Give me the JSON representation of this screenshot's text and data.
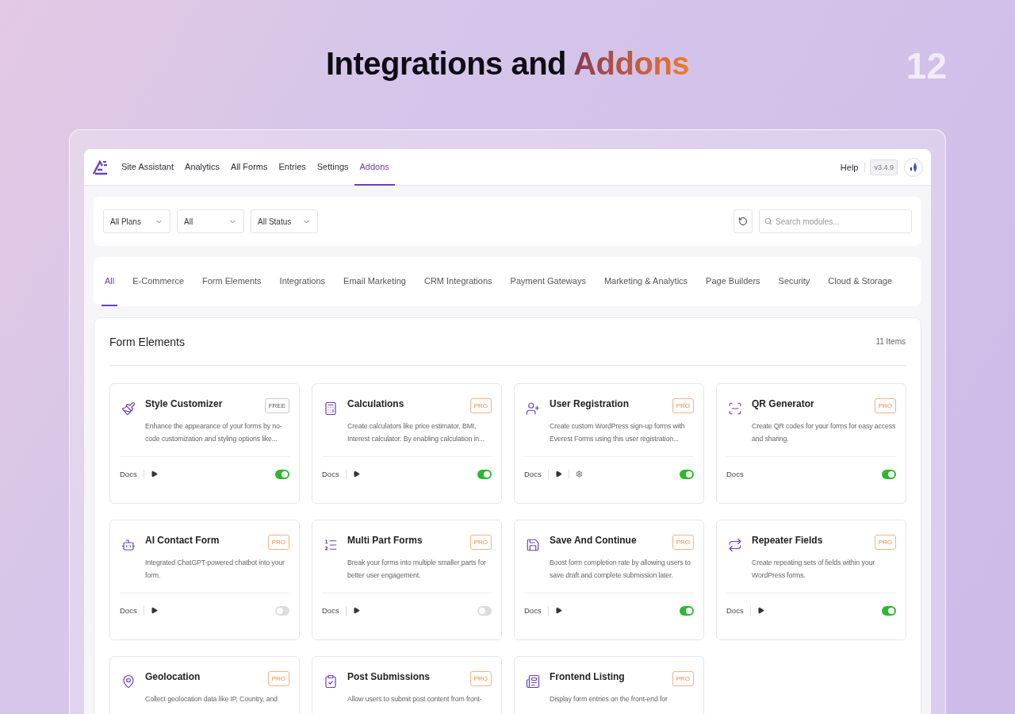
{
  "headline": {
    "prefix": "Integrations and",
    "highlight": "Addons",
    "page_number": "12"
  },
  "nav": {
    "items": [
      {
        "label": "Site Assistant",
        "selected": false
      },
      {
        "label": "Analytics",
        "selected": false
      },
      {
        "label": "All Forms",
        "selected": false
      },
      {
        "label": "Entries",
        "selected": false
      },
      {
        "label": "Settings",
        "selected": false
      },
      {
        "label": "Addons",
        "selected": true
      }
    ],
    "help": "Help",
    "version": "v3.4.9"
  },
  "filters": {
    "selects": [
      "All Plans",
      "All",
      "All Status"
    ],
    "search": {
      "placeholder": "Search modules..."
    }
  },
  "categories": [
    {
      "label": "All",
      "selected": true
    },
    {
      "label": "E-Commerce",
      "selected": false
    },
    {
      "label": "Form Elements",
      "selected": false
    },
    {
      "label": "Integrations",
      "selected": false
    },
    {
      "label": "Email Marketing",
      "selected": false
    },
    {
      "label": "CRM Integrations",
      "selected": false
    },
    {
      "label": "Payment Gateways",
      "selected": false
    },
    {
      "label": "Marketing & Analytics",
      "selected": false
    },
    {
      "label": "Page Builders",
      "selected": false
    },
    {
      "label": "Security",
      "selected": false
    },
    {
      "label": "Cloud & Storage",
      "selected": false
    }
  ],
  "section": {
    "title": "Form Elements",
    "count": "11 Items"
  },
  "addons": [
    {
      "name": "Style Customizer",
      "badge": {
        "label": "FREE",
        "kind": "free"
      },
      "description": "Enhance the appearance of your forms by no-code customization and styling options like...",
      "docs": "Docs",
      "video": true,
      "settings": false,
      "enabled": true
    },
    {
      "name": "Calculations",
      "badge": {
        "label": "PRO",
        "kind": "pro"
      },
      "description": "Create calculators like price estimator, BMI, Interest calculator. By enabling calculation in...",
      "docs": "Docs",
      "video": true,
      "settings": false,
      "enabled": true
    },
    {
      "name": "User Registration",
      "badge": {
        "label": "PRO",
        "kind": "pro"
      },
      "description": "Create custom WordPress sign-up forms with Everest Forms using this user registration...",
      "docs": "Docs",
      "video": true,
      "settings": true,
      "enabled": true
    },
    {
      "name": "QR Generator",
      "badge": {
        "label": "PRO",
        "kind": "pro"
      },
      "description": "Create QR codes for your forms for easy access and sharing.",
      "docs": "Docs",
      "video": false,
      "settings": false,
      "enabled": true
    },
    {
      "name": "AI Contact Form",
      "badge": {
        "label": "PRO",
        "kind": "pro"
      },
      "description": "Integrated ChatGPT-powered chatbot into your form.",
      "docs": "Docs",
      "video": true,
      "settings": false,
      "enabled": false
    },
    {
      "name": "Multi Part Forms",
      "badge": {
        "label": "PRO",
        "kind": "pro"
      },
      "description": "Break your forms into multiple smaller parts for better user engagement.",
      "docs": "Docs",
      "video": true,
      "settings": false,
      "enabled": false
    },
    {
      "name": "Save And Continue",
      "badge": {
        "label": "PRO",
        "kind": "pro"
      },
      "description": "Boost form completion rate by allowing users to save draft and complete submission later.",
      "docs": "Docs",
      "video": true,
      "settings": false,
      "enabled": true
    },
    {
      "name": "Repeater Fields",
      "badge": {
        "label": "PRO",
        "kind": "pro"
      },
      "description": "Create repeating sets of fields within your WordPress forms.",
      "docs": "Docs",
      "video": true,
      "settings": false,
      "enabled": true
    },
    {
      "name": "Geolocation",
      "badge": {
        "label": "PRO",
        "kind": "pro"
      },
      "description": "Collect geolocation data like IP, Country, and"
    },
    {
      "name": "Post Submissions",
      "badge": {
        "label": "PRO",
        "kind": "pro"
      },
      "description": "Allow users to submit post content from front-"
    },
    {
      "name": "Frontend Listing",
      "badge": {
        "label": "PRO",
        "kind": "pro"
      },
      "description": "Display form entries on the front-end for"
    }
  ]
}
